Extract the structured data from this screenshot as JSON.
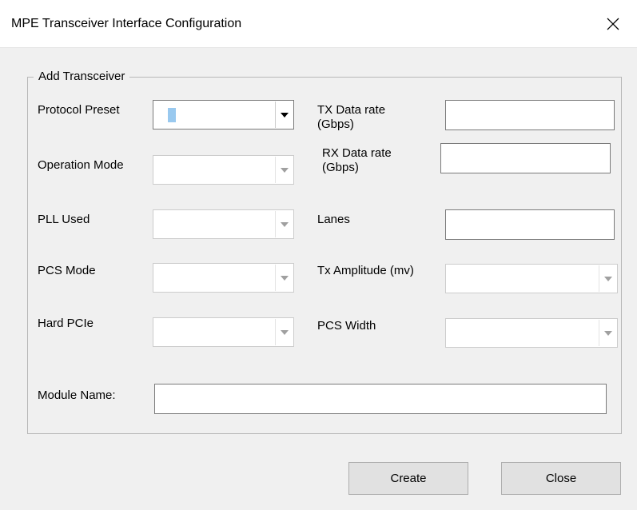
{
  "window": {
    "title": "MPE Transceiver Interface Configuration"
  },
  "group": {
    "title": "Add Transceiver"
  },
  "fields": {
    "protocol_preset": {
      "label": "Protocol Preset",
      "value": ""
    },
    "operation_mode": {
      "label": "Operation Mode",
      "value": ""
    },
    "pll_used": {
      "label": "PLL Used",
      "value": ""
    },
    "pcs_mode": {
      "label": "PCS Mode",
      "value": ""
    },
    "hard_pcie": {
      "label": "Hard PCIe",
      "value": ""
    },
    "tx_data_rate": {
      "label_line1": "TX Data rate",
      "label_line2": "(Gbps)",
      "value": ""
    },
    "rx_data_rate": {
      "label_line1": "RX Data rate",
      "label_line2": "(Gbps)",
      "value": ""
    },
    "lanes": {
      "label": "Lanes",
      "value": ""
    },
    "tx_amplitude": {
      "label": "Tx Amplitude (mv)",
      "value": ""
    },
    "pcs_width": {
      "label": "PCS Width",
      "value": ""
    },
    "module_name": {
      "label": "Module Name:",
      "value": ""
    }
  },
  "buttons": {
    "create": "Create",
    "close": "Close"
  },
  "icons": {
    "close": "close-icon",
    "dropdown": "chevron-down-icon"
  },
  "colors": {
    "selection": "#99c9ef",
    "background": "#f0f0f0",
    "titlebar": "#ffffff"
  }
}
